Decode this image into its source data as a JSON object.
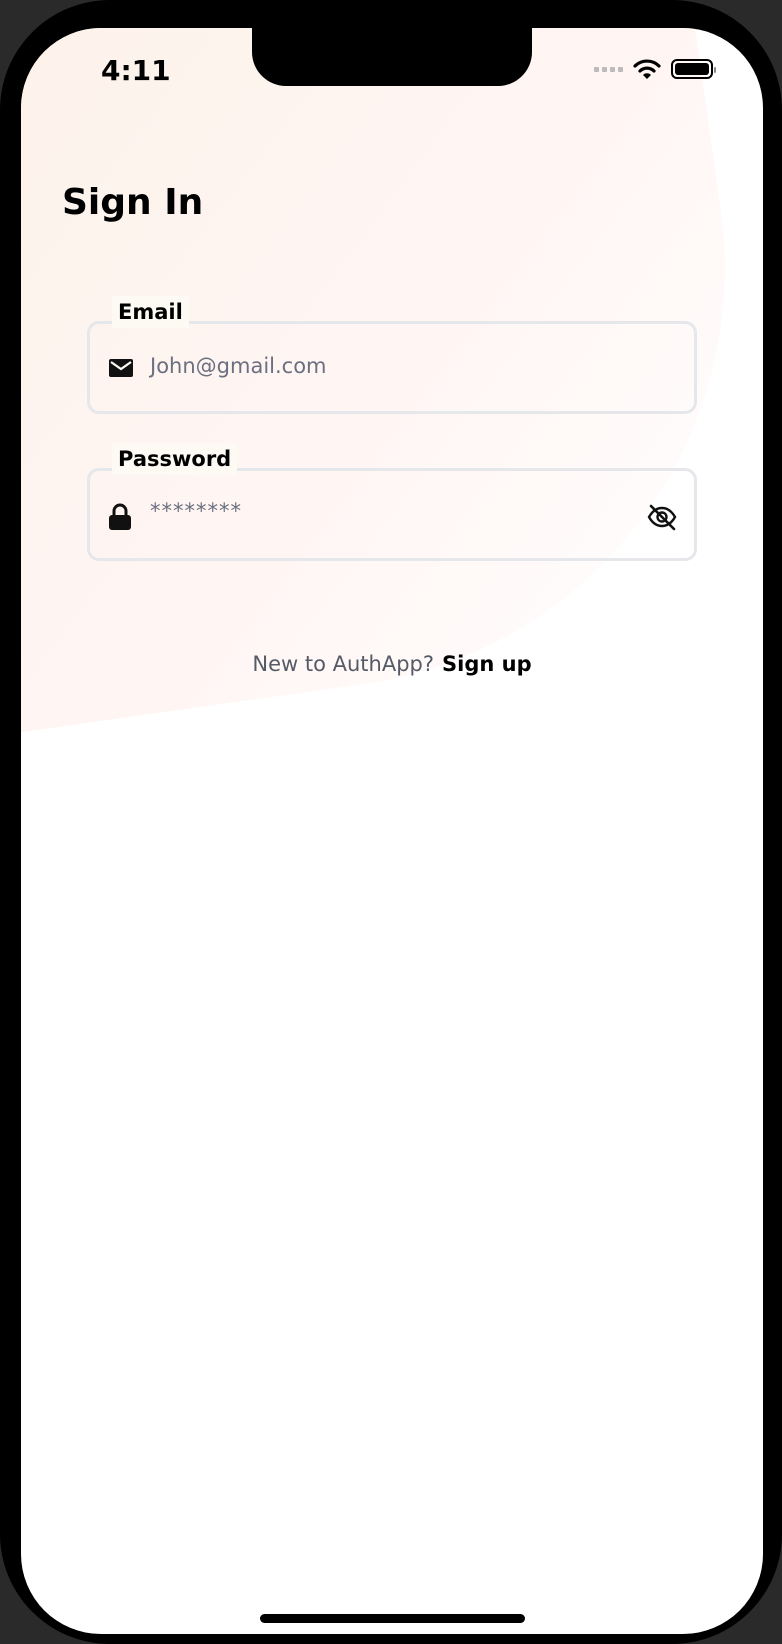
{
  "status_bar": {
    "time": "4:11"
  },
  "header": {
    "title": "Sign In"
  },
  "form": {
    "email": {
      "label": "Email",
      "value": "John@gmail.com"
    },
    "password": {
      "label": "Password",
      "value": "********"
    }
  },
  "footer": {
    "prompt": "New to AuthApp?",
    "link": "Sign up"
  }
}
